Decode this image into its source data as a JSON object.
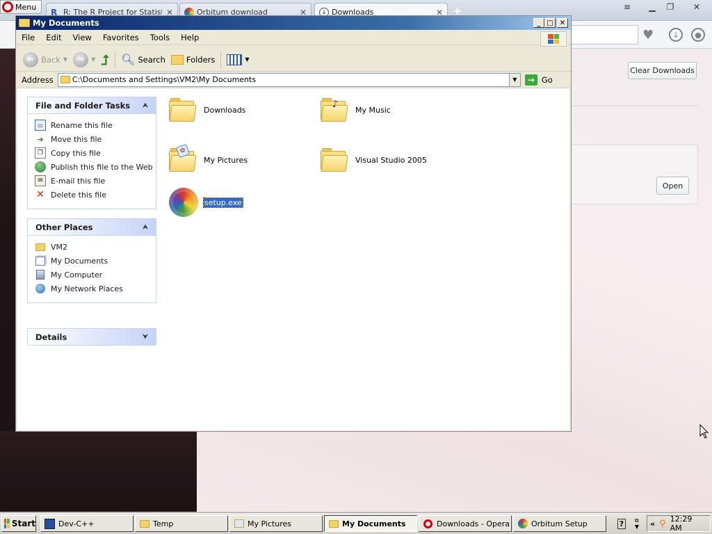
{
  "opera": {
    "menu_label": "Menu",
    "tabs": [
      {
        "label": "R: The R Project for Statistic"
      },
      {
        "label": "Orbitum download"
      },
      {
        "label": "Downloads"
      }
    ],
    "clear_downloads_label": "Clear Downloads",
    "open_label": "Open",
    "new_tab_icon": "plus-icon"
  },
  "explorer": {
    "title": "My Documents",
    "menu": [
      "File",
      "Edit",
      "View",
      "Favorites",
      "Tools",
      "Help"
    ],
    "toolbar": {
      "back": "Back",
      "search": "Search",
      "folders": "Folders"
    },
    "address_label": "Address",
    "address_value": "C:\\Documents and Settings\\VM2\\My Documents",
    "go_label": "Go",
    "tasks_panel": {
      "title": "File and Folder Tasks",
      "items": [
        {
          "label": "Rename this file",
          "icon": "rename-icon"
        },
        {
          "label": "Move this file",
          "icon": "move-icon"
        },
        {
          "label": "Copy this file",
          "icon": "copy-icon"
        },
        {
          "label": "Publish this file to the Web",
          "icon": "globe-icon"
        },
        {
          "label": "E-mail this file",
          "icon": "email-icon"
        },
        {
          "label": "Delete this file",
          "icon": "delete-icon"
        }
      ]
    },
    "places_panel": {
      "title": "Other Places",
      "items": [
        {
          "label": "VM2",
          "icon": "folder-icon"
        },
        {
          "label": "My Documents",
          "icon": "documents-icon"
        },
        {
          "label": "My Computer",
          "icon": "computer-icon"
        },
        {
          "label": "My Network Places",
          "icon": "network-icon"
        }
      ]
    },
    "details_panel": {
      "title": "Details"
    },
    "files": [
      {
        "name": "Downloads",
        "type": "folder"
      },
      {
        "name": "My Music",
        "type": "folder-music"
      },
      {
        "name": "My Pictures",
        "type": "folder-pictures"
      },
      {
        "name": "Visual Studio 2005",
        "type": "folder"
      },
      {
        "name": "setup.exe",
        "type": "exe",
        "selected": true
      }
    ]
  },
  "taskbar": {
    "start_label": "Start",
    "tasks": [
      {
        "label": "Dev-C++",
        "icon": "devcpp-icon"
      },
      {
        "label": "Temp",
        "icon": "folder-icon"
      },
      {
        "label": "My Pictures",
        "icon": "pictures-icon"
      },
      {
        "label": "My Documents",
        "icon": "folder-icon",
        "active": true
      },
      {
        "label": "Downloads - Opera",
        "icon": "opera-icon"
      },
      {
        "label": "Orbitum Setup",
        "icon": "orbitum-icon"
      }
    ],
    "clock": "12:29 AM"
  }
}
